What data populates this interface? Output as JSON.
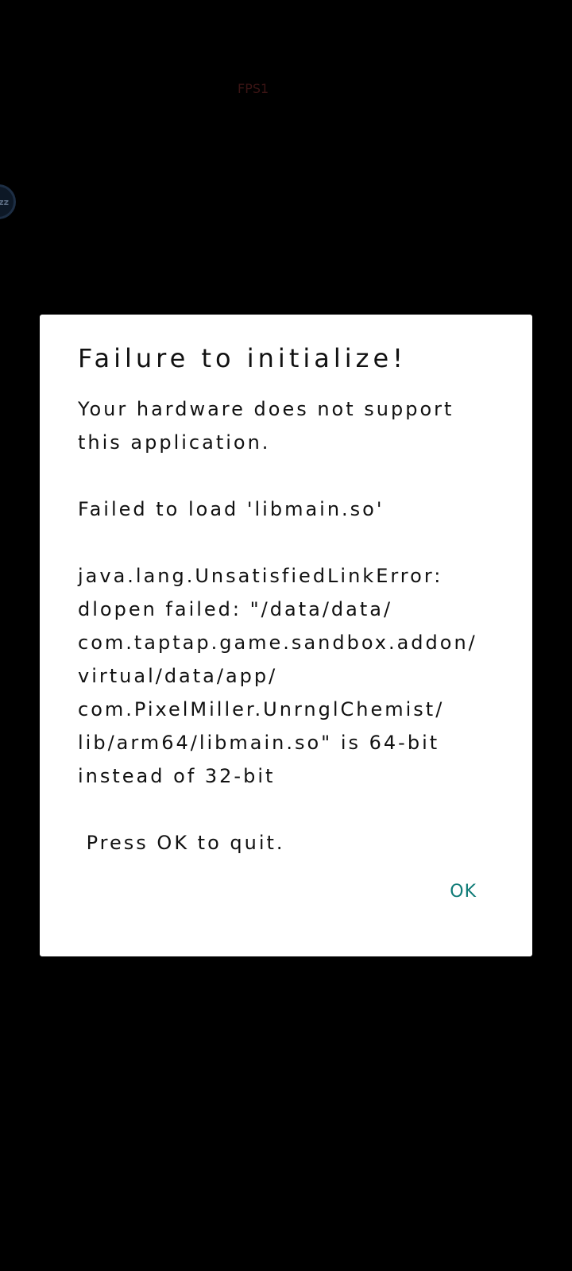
{
  "overlay": {
    "fps_label": "FPS1",
    "floating_ball_label": "zz"
  },
  "dialog": {
    "title": "Failure to initialize!",
    "message_lines": [
      "Your hardware does not support",
      "this application.",
      "",
      "Failed to load 'libmain.so'",
      "",
      "java.lang.UnsatisfiedLinkError:",
      "dlopen failed: \"/data/data/",
      "com.taptap.game.sandbox.addon/",
      "virtual/data/app/",
      "com.PixelMiller.UnrnglChemist/",
      "lib/arm64/libmain.so\" is 64-bit",
      "instead of 32-bit",
      "",
      " Press OK to quit."
    ],
    "ok_label": "OK"
  },
  "colors": {
    "background": "#000000",
    "dialog_background": "#ffffff",
    "text": "#111111",
    "accent": "#0f7b77"
  }
}
